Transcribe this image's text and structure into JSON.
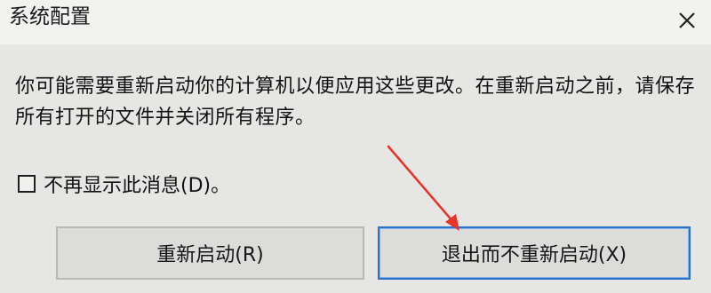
{
  "window": {
    "title": "系统配置"
  },
  "message": {
    "text": "你可能需要重新启动你的计算机以便应用这些更改。在重新启动之前，请保存所有打开的文件并关闭所有程序。"
  },
  "options": {
    "dont_show_label": "不再显示此消息(D)。",
    "dont_show_checked": false
  },
  "buttons": {
    "restart_label": "重新启动(R)",
    "exit_label": "退出而不重新启动(X)"
  },
  "icons": {
    "close": "close-icon",
    "annotation": "red-arrow-icon"
  },
  "colors": {
    "annotation_arrow": "#e8332a",
    "focus_border": "#2a73c8"
  }
}
